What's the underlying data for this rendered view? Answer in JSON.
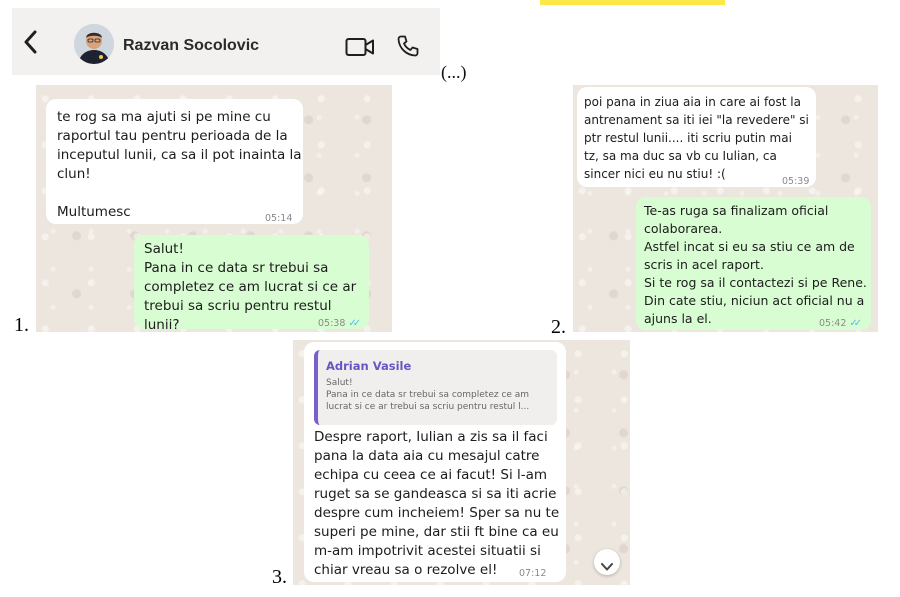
{
  "header": {
    "contact_name": "Razvan Socolovic",
    "back_icon": "chevron-left-icon",
    "video_icon": "video-camera-icon",
    "phone_icon": "phone-icon"
  },
  "ellipsis": "(...)",
  "screenshots": [
    {
      "number": "1.",
      "messages": [
        {
          "direction": "incoming",
          "text": "te rog sa ma ajuti si pe mine cu\nraportul tau pentru perioada de la\ninceputul lunii, ca sa il pot inainta la\nclun!\n\nMultumesc",
          "time": "05:14"
        },
        {
          "direction": "outgoing",
          "text": "Salut!\nPana in ce data sr trebui sa\ncompletez ce am lucrat si ce ar\ntrebui sa scriu pentru restul lunii?",
          "time": "05:38"
        }
      ]
    },
    {
      "number": "2.",
      "messages": [
        {
          "direction": "incoming",
          "text": "poi pana in ziua aia in care ai fost la\nantrenament sa iti iei \"la revedere\" si\nptr restul lunii.... iti scriu putin mai\ntz, sa ma duc sa vb cu Iulian, ca\nsincer nici eu nu stiu! :(",
          "time": "05:39"
        },
        {
          "direction": "outgoing",
          "text": "Te-as ruga sa finalizam oficial\ncolaborarea.\nAstfel incat si eu sa stiu ce am de\nscris in acel raport.\nSi te rog sa il contactezi si pe Rene.\nDin cate stiu, niciun act oficial nu a\najuns la el.",
          "time": "05:42"
        }
      ]
    },
    {
      "number": "3.",
      "quote": {
        "sender": "Adrian Vasile",
        "text": "Salut!\nPana in ce data sr trebui sa completez ce am\nlucrat si ce ar trebui sa scriu pentru restul l..."
      },
      "messages": [
        {
          "direction": "incoming",
          "text": "Despre raport, Iulian a zis sa il faci\npana la data aia cu mesajul catre\nechipa cu ceea ce ai facut! Si l-am\nruget sa se gandeasca si sa iti acrie\ndespre cum incheiem! Sper sa nu te\nsuperi pe mine, dar stii ft bine ca eu\nm-am impotrivit acestei situatii si\nchiar vreau sa o rezolve el!",
          "time": "07:12"
        }
      ],
      "scroll_icon": "chevron-down-icon"
    }
  ],
  "colors": {
    "incoming_bubble": "#ffffff",
    "outgoing_bubble": "#d9fdd3",
    "chat_background": "#ece6de",
    "read_ticks": "#53bdeb",
    "quote_accent": "#7a5fc9"
  }
}
